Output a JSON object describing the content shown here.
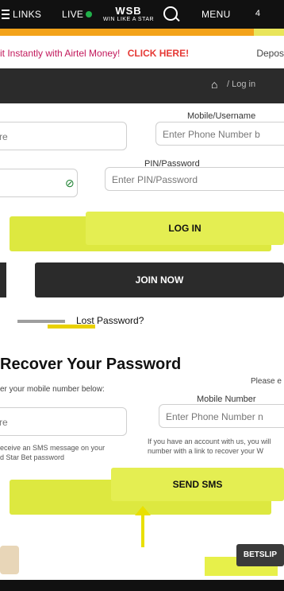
{
  "topbar": {
    "links": "LINKS",
    "live": "LIVE",
    "logo": "WSB",
    "logo_sub": "WIN LIKE A STAR",
    "menu": "MENU",
    "count": "4"
  },
  "promo": {
    "text": "it Instantly with Airtel Money!",
    "link": "CLICK HERE!",
    "deposit": "Depos"
  },
  "breadcrumb": {
    "current": "Log in"
  },
  "login": {
    "mobile_label": "Mobile/Username",
    "mobile_placeholder": "Enter Phone Number b",
    "left_field_value": "re",
    "pin_label": "PIN/Password",
    "pin_placeholder": "Enter PIN/Password",
    "login_button": "LOG IN",
    "login_button_ghost": "LOG IN",
    "join_button": "JOIN NOW",
    "lost_password": "Lost Password?"
  },
  "recover": {
    "heading": "Recover Your Password",
    "please": "Please e",
    "instruction": "er your mobile number below:",
    "mobile_label": "Mobile Number",
    "mobile_placeholder": "Enter Phone Number n",
    "left_field_value": "re",
    "sms_note_left": "eceive an SMS message on your\nd Star Bet password",
    "sms_note_right": "If you have an account with us, you will\nnumber with a link to recover your W",
    "send_sms": "SEND SMS",
    "send_sms_ghost": "SEND SMS"
  },
  "betslip": {
    "label": "BETSLIP"
  }
}
